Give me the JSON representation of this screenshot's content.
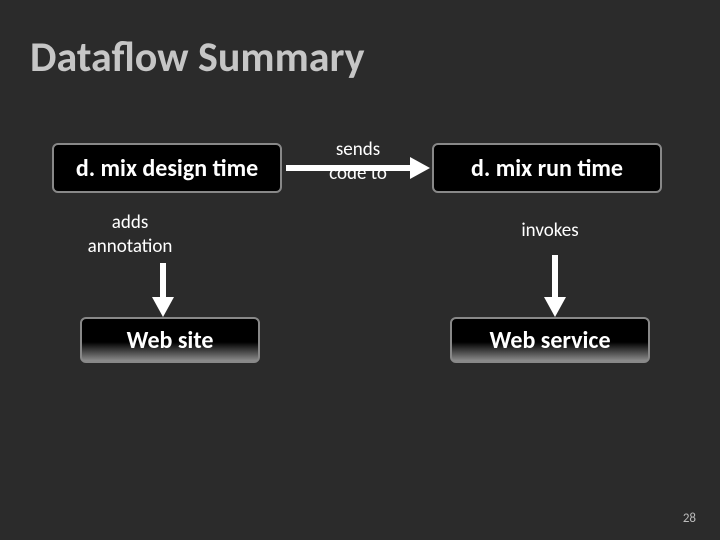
{
  "title": "Dataflow Summary",
  "slide_number": "28",
  "nodes": {
    "design_time": "d. mix design time",
    "run_time": "d. mix run time",
    "web_site": "Web site",
    "web_service": "Web service"
  },
  "edges": {
    "sends_line1": "sends",
    "sends_line2": "code to",
    "adds_line1": "adds",
    "adds_line2": "annotation",
    "invokes": "invokes"
  },
  "colors": {
    "bg": "#2b2b2b",
    "title": "#c6c6c6",
    "node_bg": "#000000",
    "node_border": "#888888",
    "text": "#ffffff",
    "arrow": "#ffffff"
  }
}
